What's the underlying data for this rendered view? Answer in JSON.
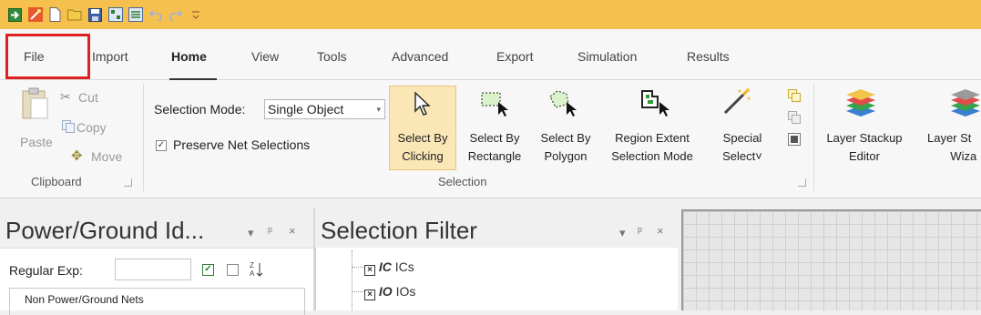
{
  "quick_access": {
    "icons": [
      "import-icon",
      "wizard-icon",
      "new-file-icon",
      "open-folder-icon",
      "save-icon",
      "layout-icon",
      "layout2-icon",
      "undo-icon",
      "redo-icon",
      "customize-icon"
    ],
    "colors": {
      "bar": "#f5c04e"
    }
  },
  "tabs": [
    {
      "label": "File"
    },
    {
      "label": "Import"
    },
    {
      "label": "Home"
    },
    {
      "label": "View"
    },
    {
      "label": "Tools"
    },
    {
      "label": "Advanced"
    },
    {
      "label": "Export"
    },
    {
      "label": "Simulation"
    },
    {
      "label": "Results"
    }
  ],
  "active_tab": "Home",
  "ribbon": {
    "clipboard": {
      "paste": "Paste",
      "cut": "Cut",
      "copy": "Copy",
      "move": "Move",
      "group_label": "Clipboard"
    },
    "selection": {
      "mode_label": "Selection Mode:",
      "mode_value": "Single Object",
      "preserve_label": "Preserve Net Selections",
      "preserve_checked": true,
      "buttons": [
        {
          "line1": "Select By",
          "line2": "Clicking"
        },
        {
          "line1": "Select By",
          "line2": "Rectangle"
        },
        {
          "line1": "Select By",
          "line2": "Polygon"
        },
        {
          "line1": "Region Extent",
          "line2": "Selection Mode"
        },
        {
          "line1": "Special",
          "line2": "Select˅"
        }
      ],
      "group_label": "Selection"
    },
    "layer": {
      "btn1_line1": "Layer Stackup",
      "btn1_line2": "Editor",
      "btn2_line1": "Layer St",
      "btn2_line2": "Wiza"
    }
  },
  "power_ground_panel": {
    "title": "Power/Ground Id...",
    "regexp_label": "Regular Exp:",
    "group_label": "Non Power/Ground Nets"
  },
  "selection_filter_panel": {
    "title": "Selection Filter",
    "items": [
      {
        "code": "IC",
        "label": "ICs",
        "checked": true
      },
      {
        "code": "IO",
        "label": "IOs",
        "checked": true
      }
    ]
  },
  "panel_controls": {
    "dropdown": "▾",
    "pin": "ᵖ",
    "close": "×"
  }
}
